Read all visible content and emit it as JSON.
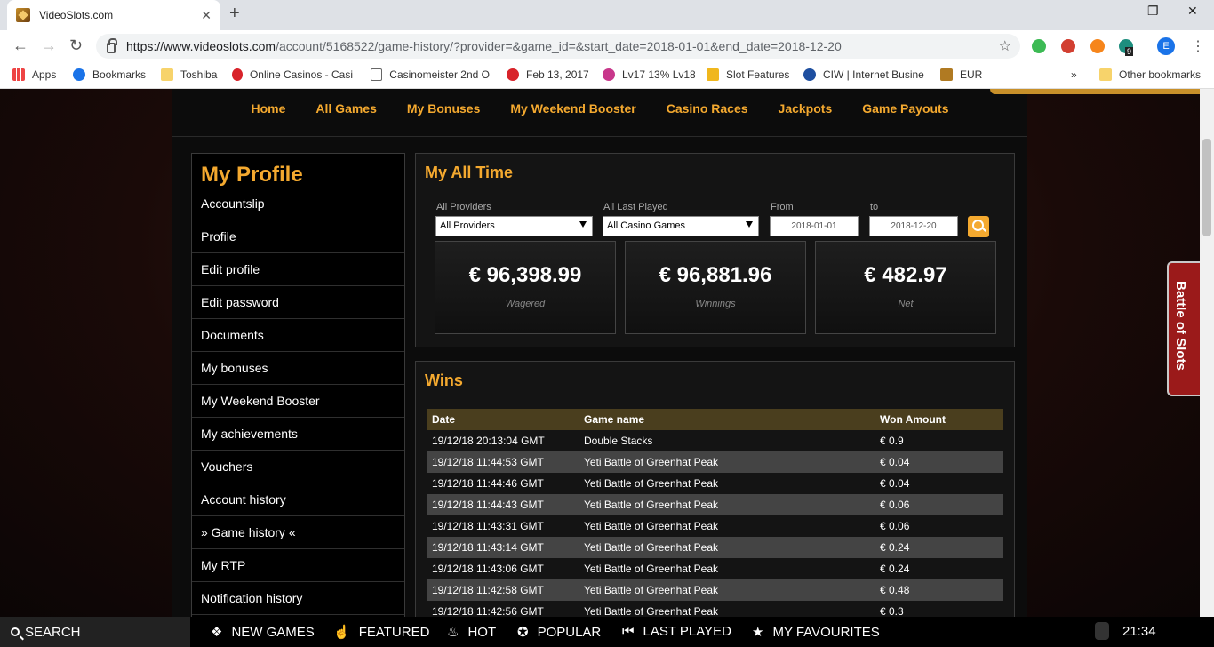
{
  "browser": {
    "tab_title": "VideoSlots.com",
    "tab_close": "✕",
    "new_tab": "+",
    "url_host": "https://www.videoslots.com",
    "url_rest": "/account/5168522/game-history/?provider=&game_id=&start_date=2018-01-01&end_date=2018-12-20",
    "profile_initial": "E",
    "ext_badge": "9",
    "bookmarks": [
      "Apps",
      "Bookmarks",
      "Toshiba",
      "Online Casinos - Casi",
      "Casinomeister 2nd O",
      "Feb 13, 2017",
      "Lv17 13% Lv18",
      "Slot Features",
      "CIW | Internet Busine",
      "EUR",
      "»",
      "Other bookmarks"
    ]
  },
  "topnav": [
    "Home",
    "All Games",
    "My Bonuses",
    "My Weekend Booster",
    "Casino Races",
    "Jackpots",
    "Game Payouts"
  ],
  "sidebar": {
    "title": "My Profile",
    "items": [
      "Accountslip",
      "Profile",
      "Edit profile",
      "Edit password",
      "Documents",
      "My bonuses",
      "My Weekend Booster",
      "My achievements",
      "Vouchers",
      "Account history",
      "» Game history «",
      "My RTP",
      "Notification history"
    ]
  },
  "alltime": {
    "title": "My All Time",
    "filters": {
      "providers_label": "All Providers",
      "providers_value": "All Providers",
      "played_label": "All Last Played",
      "played_value": "All Casino Games",
      "from_label": "From",
      "from_value": "2018-01-01",
      "to_label": "to",
      "to_value": "2018-12-20"
    },
    "stats": [
      {
        "value": "€ 96,398.99",
        "label": "Wagered"
      },
      {
        "value": "€ 96,881.96",
        "label": "Winnings"
      },
      {
        "value": "€ 482.97",
        "label": "Net"
      }
    ]
  },
  "wins": {
    "title": "Wins",
    "columns": [
      "Date",
      "Game name",
      "Won Amount"
    ],
    "rows": [
      [
        "19/12/18 20:13:04 GMT",
        "Double Stacks",
        "€ 0.9"
      ],
      [
        "19/12/18 11:44:53 GMT",
        "Yeti Battle of Greenhat Peak",
        "€ 0.04"
      ],
      [
        "19/12/18 11:44:46 GMT",
        "Yeti Battle of Greenhat Peak",
        "€ 0.04"
      ],
      [
        "19/12/18 11:44:43 GMT",
        "Yeti Battle of Greenhat Peak",
        "€ 0.06"
      ],
      [
        "19/12/18 11:43:31 GMT",
        "Yeti Battle of Greenhat Peak",
        "€ 0.06"
      ],
      [
        "19/12/18 11:43:14 GMT",
        "Yeti Battle of Greenhat Peak",
        "€ 0.24"
      ],
      [
        "19/12/18 11:43:06 GMT",
        "Yeti Battle of Greenhat Peak",
        "€ 0.24"
      ],
      [
        "19/12/18 11:42:58 GMT",
        "Yeti Battle of Greenhat Peak",
        "€ 0.48"
      ],
      [
        "19/12/18 11:42:56 GMT",
        "Yeti Battle of Greenhat Peak",
        "€ 0.3"
      ]
    ]
  },
  "battle_tab": "Battle of Slots",
  "bottombar": {
    "search": "SEARCH",
    "items": [
      {
        "icon": "cube-icon",
        "glyph": "❖",
        "label": "NEW GAMES"
      },
      {
        "icon": "thumbs-up-icon",
        "glyph": "☝",
        "label": "FEATURED"
      },
      {
        "icon": "flame-icon",
        "glyph": "♨",
        "label": "HOT"
      },
      {
        "icon": "popular-icon",
        "glyph": "✪",
        "label": "POPULAR"
      },
      {
        "icon": "rewind-icon",
        "glyph": "⏮",
        "label": "LAST PLAYED"
      },
      {
        "icon": "star-icon",
        "glyph": "★",
        "label": "MY FAVOURITES"
      }
    ],
    "time": "21:34"
  },
  "colors": {
    "accent": "#f4a92f",
    "header_row": "#4a3e1e",
    "battle_tab": "#9b1a1a"
  }
}
